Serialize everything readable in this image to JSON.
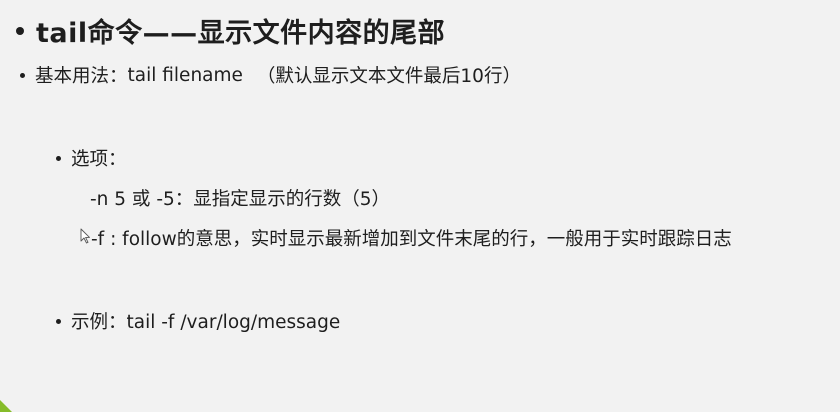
{
  "slide": {
    "title": "tail命令——显示文件内容的尾部",
    "usage": {
      "label": "基本用法：",
      "command": "tail filename",
      "note": "（默认显示文本文件最后10行）"
    },
    "options": {
      "heading": "选项：",
      "items": [
        {
          "text": "-n 5 或 -5：显指定显示的行数（5）"
        },
        {
          "text": "-f : follow的意思，实时显示最新增加到文件末尾的行，一般用于实时跟踪日志"
        }
      ]
    },
    "example": {
      "text": "示例：tail -f /var/log/message"
    }
  },
  "colors": {
    "background": "#f2f2f2",
    "text": "#1e1e1e",
    "accent": "#86bc2a"
  },
  "icons": [
    "bullet-icon",
    "mouse-pointer-icon"
  ]
}
